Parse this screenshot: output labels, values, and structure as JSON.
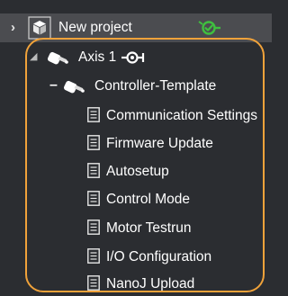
{
  "tree": {
    "project": {
      "label": "New project",
      "expander": "›",
      "icon": "cube-icon",
      "status_icon": "connected-icon",
      "status_color": "#3fbf3f"
    },
    "axis": {
      "label": "Axis 1",
      "icon": "motor-icon",
      "status_icon": "axis-link-icon"
    },
    "controller": {
      "label": "Controller-Template",
      "expander": "–",
      "icon": "controller-icon"
    },
    "items": [
      {
        "label": "Communication Settings",
        "icon": "document-icon"
      },
      {
        "label": "Firmware Update",
        "icon": "document-icon"
      },
      {
        "label": "Autosetup",
        "icon": "document-icon"
      },
      {
        "label": "Control Mode",
        "icon": "document-icon"
      },
      {
        "label": "Motor Testrun",
        "icon": "document-icon"
      },
      {
        "label": "I/O Configuration",
        "icon": "document-icon"
      },
      {
        "label": "NanoJ Upload",
        "icon": "document-icon"
      }
    ]
  },
  "colors": {
    "background": "#2b2d31",
    "selected_row": "#4b4c50",
    "highlight_border": "#f0a23a",
    "text": "#ffffff"
  }
}
